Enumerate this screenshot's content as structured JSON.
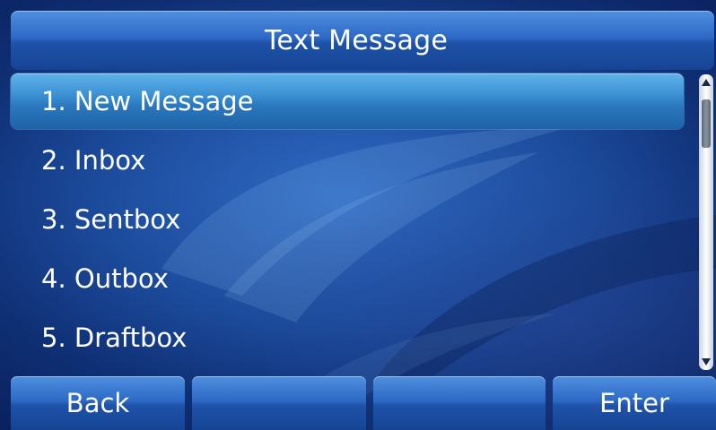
{
  "title": "Text Message",
  "menu": {
    "selected_index": 0,
    "items": [
      {
        "label": "1. New Message"
      },
      {
        "label": "2. Inbox"
      },
      {
        "label": "3. Sentbox"
      },
      {
        "label": "4. Outbox"
      },
      {
        "label": "5. Draftbox"
      }
    ]
  },
  "softkeys": [
    {
      "label": "Back"
    },
    {
      "label": ""
    },
    {
      "label": ""
    },
    {
      "label": "Enter"
    }
  ],
  "icons": {
    "scroll_up": "scroll-up-arrow-icon",
    "scroll_down": "scroll-down-arrow-icon"
  },
  "colors": {
    "background": "#1c4b9c",
    "title_bar": "#2e6ac6",
    "selected_item": "#3a8fd2",
    "text": "#ffffff"
  }
}
